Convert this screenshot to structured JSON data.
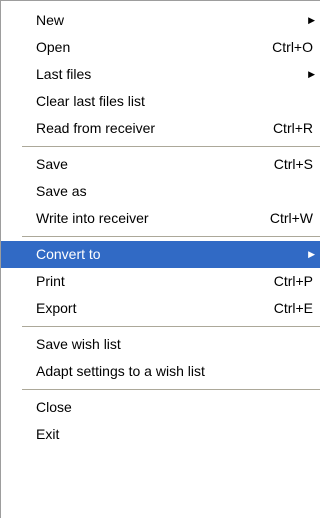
{
  "groups": [
    [
      {
        "label": "New",
        "shortcut": "",
        "submenu": true
      },
      {
        "label": "Open",
        "shortcut": "Ctrl+O",
        "submenu": false
      },
      {
        "label": "Last files",
        "shortcut": "",
        "submenu": true
      },
      {
        "label": "Clear last files list",
        "shortcut": "",
        "submenu": false
      },
      {
        "label": "Read from receiver",
        "shortcut": "Ctrl+R",
        "submenu": false
      }
    ],
    [
      {
        "label": "Save",
        "shortcut": "Ctrl+S",
        "submenu": false
      },
      {
        "label": "Save as",
        "shortcut": "",
        "submenu": false
      },
      {
        "label": "Write into receiver",
        "shortcut": "Ctrl+W",
        "submenu": false
      }
    ],
    [
      {
        "label": "Convert to",
        "shortcut": "",
        "submenu": true,
        "highlighted": true
      },
      {
        "label": "Print",
        "shortcut": "Ctrl+P",
        "submenu": false
      },
      {
        "label": "Export",
        "shortcut": "Ctrl+E",
        "submenu": false
      }
    ],
    [
      {
        "label": "Save wish list",
        "shortcut": "",
        "submenu": false
      },
      {
        "label": "Adapt settings to a wish list",
        "shortcut": "",
        "submenu": false
      }
    ],
    [
      {
        "label": "Close",
        "shortcut": "",
        "submenu": false
      },
      {
        "label": "Exit",
        "shortcut": "",
        "submenu": false
      }
    ]
  ],
  "submenu_arrow_icon": "triangle-right-icon",
  "colors": {
    "highlight_bg": "#316ac5",
    "highlight_text": "#ffffff",
    "separator": "#aca899"
  }
}
